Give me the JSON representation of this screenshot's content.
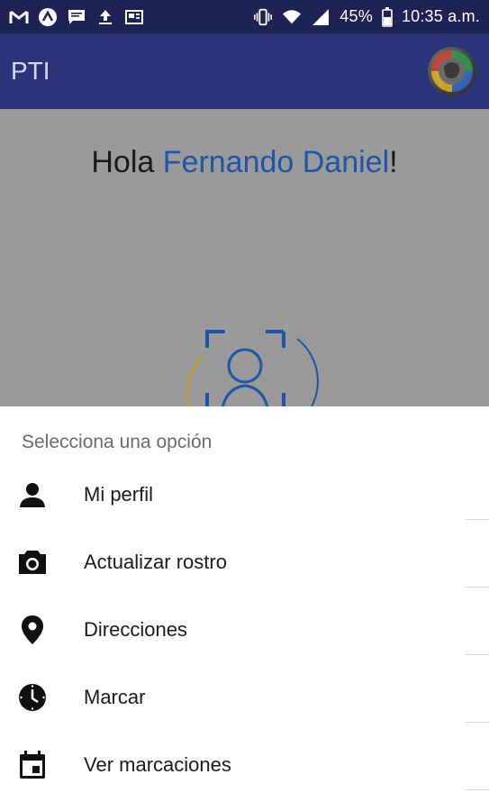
{
  "status_bar": {
    "battery": "45%",
    "time": "10:35 a.m.",
    "icons_left": [
      "gmail-icon",
      "app-icon",
      "message-icon",
      "upload-icon",
      "news-icon"
    ],
    "icons_right": [
      "vibrate-icon",
      "wifi-icon",
      "signal-icon",
      "battery-icon"
    ]
  },
  "app_bar": {
    "title": "PTI",
    "logo_icon": "globe-logo-icon"
  },
  "content": {
    "greeting_prefix": "Hola",
    "user_name": "Fernando Daniel",
    "greeting_suffix": "!"
  },
  "bottom_sheet": {
    "title": "Selecciona una opción",
    "items": [
      {
        "label": "Mi perfil",
        "icon": "person-icon"
      },
      {
        "label": "Actualizar rostro",
        "icon": "camera-icon"
      },
      {
        "label": "Direcciones",
        "icon": "location-pin-icon"
      },
      {
        "label": "Marcar",
        "icon": "clock-icon"
      },
      {
        "label": "Ver marcaciones",
        "icon": "calendar-icon"
      }
    ]
  },
  "colors": {
    "status_bar": "#1d2455",
    "app_bar": "#2c3479",
    "dim_overlay": "#9a9a9a",
    "name_accent": "#1d55a8"
  }
}
